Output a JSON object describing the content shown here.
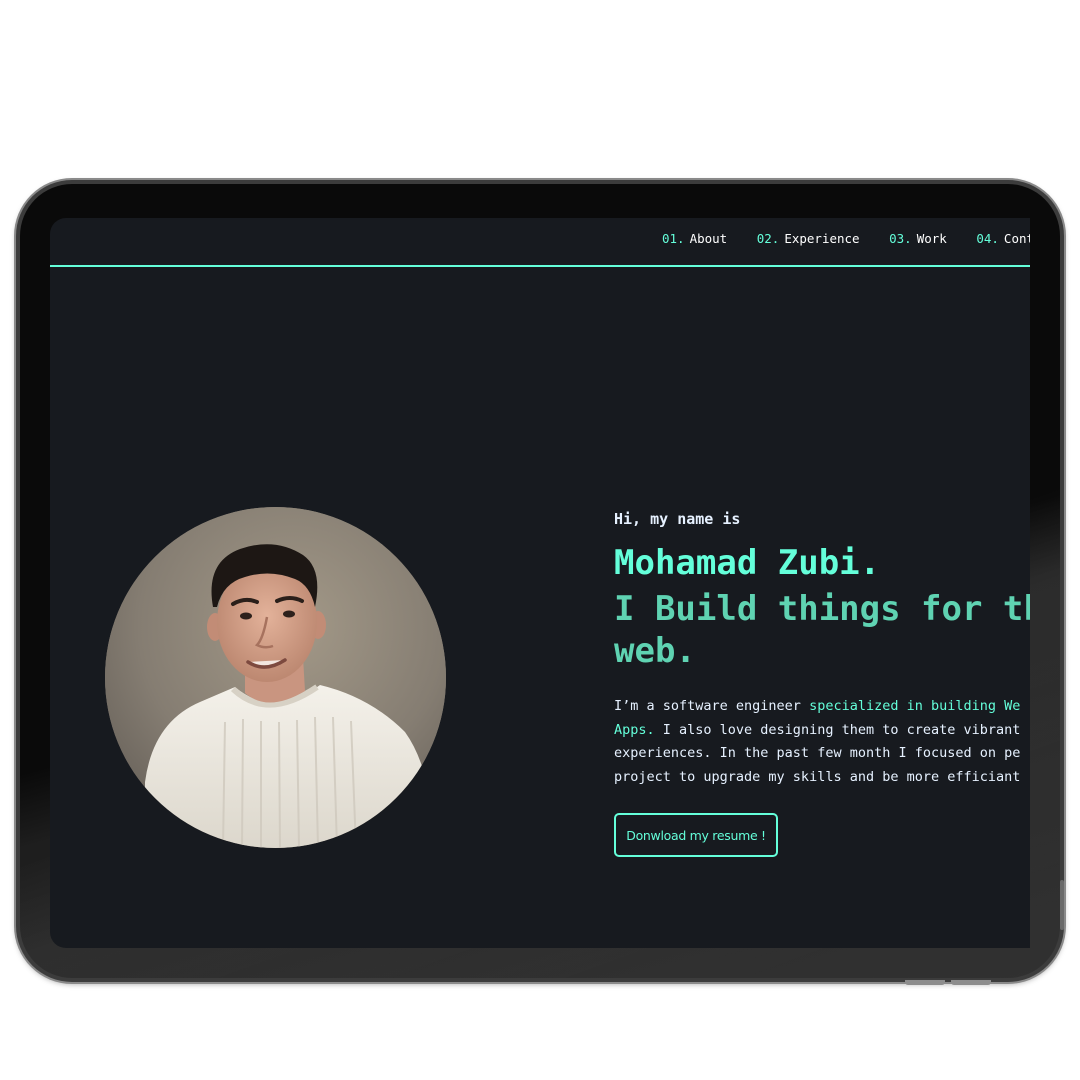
{
  "nav": {
    "items": [
      {
        "number": "01.",
        "label": "About"
      },
      {
        "number": "02.",
        "label": "Experience"
      },
      {
        "number": "03.",
        "label": "Work"
      },
      {
        "number": "04.",
        "label": "Cont"
      }
    ]
  },
  "hero": {
    "greeting": "Hi, my name is",
    "name": "Mohamad Zubi.",
    "tagline_line1": "I Build things for th",
    "tagline_line2": "web.",
    "bio": {
      "line1_plain": "I’m a software engineer ",
      "line1_accent": "specialized in building We",
      "line2_accent": "Apps.",
      "line2_plain": " I also love designing them to create vibrant",
      "line3": "experiences. In the past few month I focused on pe",
      "line4": "project to upgrade my skills and be more efficiant"
    },
    "resume_button": "Donwload my resume !"
  },
  "colors": {
    "accent": "#64ffda",
    "background": "#171a1f",
    "text": "#e6f1ff"
  },
  "photo": {
    "alt": "profile-photo"
  }
}
